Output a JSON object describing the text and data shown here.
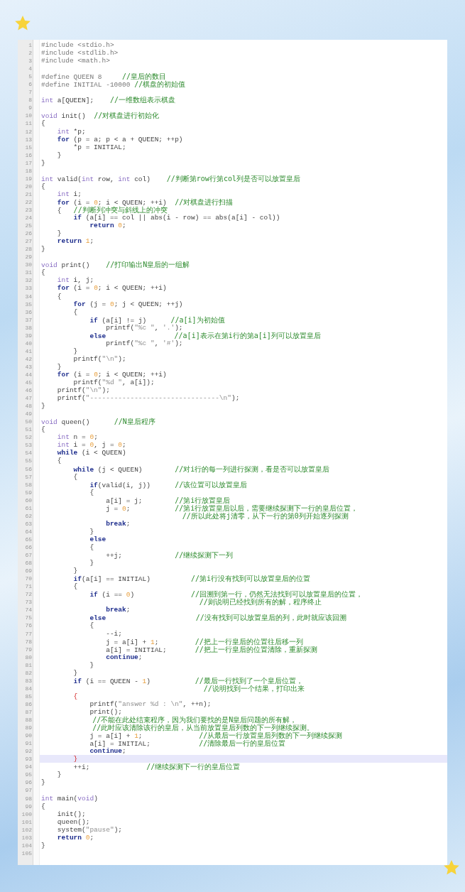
{
  "lines": [
    {
      "number": "1",
      "tokens": [
        {
          "kind": "pre",
          "text": "#include <stdio.h>"
        }
      ]
    },
    {
      "number": "2",
      "tokens": [
        {
          "kind": "pre",
          "text": "#include <stdlib.h>"
        }
      ]
    },
    {
      "number": "3",
      "tokens": [
        {
          "kind": "pre",
          "text": "#include <math.h>"
        }
      ]
    },
    {
      "number": "4"
    },
    {
      "number": "5",
      "tokens": [
        {
          "kind": "pre",
          "text": "#define QUEEN 8     "
        },
        {
          "kind": "comment",
          "text": "//皇后的数目"
        }
      ]
    },
    {
      "number": "6",
      "tokens": [
        {
          "kind": "pre",
          "text": "#define INITIAL -10000 "
        },
        {
          "kind": "comment",
          "text": "//棋盘的初始值"
        }
      ]
    },
    {
      "number": "7"
    },
    {
      "number": "8",
      "tokens": [
        {
          "kind": "type",
          "text": "int"
        },
        {
          "kind": "plain",
          "text": " a[QUEEN];    "
        },
        {
          "kind": "comment",
          "text": "//一维数组表示棋盘"
        }
      ]
    },
    {
      "number": "9"
    },
    {
      "number": "10",
      "tokens": [
        {
          "kind": "type",
          "text": "void"
        },
        {
          "kind": "plain",
          "text": " init()  "
        },
        {
          "kind": "comment",
          "text": "//对棋盘进行初始化"
        }
      ]
    },
    {
      "number": "11",
      "tokens": [
        {
          "kind": "plain",
          "text": "{"
        }
      ]
    },
    {
      "number": "12",
      "tokens": [
        {
          "kind": "type",
          "text": "    int"
        },
        {
          "kind": "plain",
          "text": " *p;"
        }
      ]
    },
    {
      "number": "13",
      "tokens": [
        {
          "kind": "keyword",
          "text": "    for"
        },
        {
          "kind": "plain",
          "text": " (p = a; p < a + QUEEN; ++p)"
        }
      ]
    },
    {
      "number": "15",
      "tokens": [
        {
          "kind": "plain",
          "text": "        *p = INITIAL;"
        }
      ]
    },
    {
      "number": "16",
      "tokens": [
        {
          "kind": "plain",
          "text": "    }"
        }
      ]
    },
    {
      "number": "17",
      "tokens": [
        {
          "kind": "plain",
          "text": "}"
        }
      ]
    },
    {
      "number": "18"
    },
    {
      "number": "19",
      "tokens": [
        {
          "kind": "type",
          "text": "int"
        },
        {
          "kind": "plain",
          "text": " valid("
        },
        {
          "kind": "type",
          "text": "int"
        },
        {
          "kind": "plain",
          "text": " row, "
        },
        {
          "kind": "type",
          "text": "int"
        },
        {
          "kind": "plain",
          "text": " col)    "
        },
        {
          "kind": "comment",
          "text": "//判断第row行第col列是否可以放置皇后"
        }
      ]
    },
    {
      "number": "20",
      "tokens": [
        {
          "kind": "plain",
          "text": "{"
        }
      ]
    },
    {
      "number": "21",
      "tokens": [
        {
          "kind": "type",
          "text": "    int"
        },
        {
          "kind": "plain",
          "text": " i;"
        }
      ]
    },
    {
      "number": "22",
      "tokens": [
        {
          "kind": "keyword",
          "text": "    for"
        },
        {
          "kind": "plain",
          "text": " (i = "
        },
        {
          "kind": "number",
          "text": "0"
        },
        {
          "kind": "plain",
          "text": "; i < QUEEN; ++i)  "
        },
        {
          "kind": "comment",
          "text": "//对棋盘进行扫描"
        }
      ]
    },
    {
      "number": "23",
      "tokens": [
        {
          "kind": "plain",
          "text": "    {   "
        },
        {
          "kind": "comment",
          "text": "//判断列冲突与斜线上的冲突"
        }
      ]
    },
    {
      "number": "24",
      "tokens": [
        {
          "kind": "keyword",
          "text": "        if"
        },
        {
          "kind": "plain",
          "text": " (a[i] == col || abs(i - row) == abs(a[i] - col))"
        }
      ]
    },
    {
      "number": "25",
      "tokens": [
        {
          "kind": "keyword",
          "text": "            return "
        },
        {
          "kind": "number",
          "text": "0"
        },
        {
          "kind": "plain",
          "text": ";"
        }
      ]
    },
    {
      "number": "26",
      "tokens": [
        {
          "kind": "plain",
          "text": "    }"
        }
      ]
    },
    {
      "number": "27",
      "tokens": [
        {
          "kind": "keyword",
          "text": "    return "
        },
        {
          "kind": "number",
          "text": "1"
        },
        {
          "kind": "plain",
          "text": ";"
        }
      ]
    },
    {
      "number": "28",
      "tokens": [
        {
          "kind": "plain",
          "text": "}"
        }
      ]
    },
    {
      "number": "29"
    },
    {
      "number": "30",
      "tokens": [
        {
          "kind": "type",
          "text": "void"
        },
        {
          "kind": "plain",
          "text": " print()    "
        },
        {
          "kind": "comment",
          "text": "//打印输出N皇后的一组解"
        }
      ]
    },
    {
      "number": "31",
      "tokens": [
        {
          "kind": "plain",
          "text": "{"
        }
      ]
    },
    {
      "number": "32",
      "tokens": [
        {
          "kind": "type",
          "text": "    int"
        },
        {
          "kind": "plain",
          "text": " i, j;"
        }
      ]
    },
    {
      "number": "33",
      "tokens": [
        {
          "kind": "keyword",
          "text": "    for"
        },
        {
          "kind": "plain",
          "text": " (i = "
        },
        {
          "kind": "number",
          "text": "0"
        },
        {
          "kind": "plain",
          "text": "; i < QUEEN; ++i)"
        }
      ]
    },
    {
      "number": "34",
      "tokens": [
        {
          "kind": "plain",
          "text": "    {"
        }
      ]
    },
    {
      "number": "35",
      "tokens": [
        {
          "kind": "keyword",
          "text": "        for"
        },
        {
          "kind": "plain",
          "text": " (j = "
        },
        {
          "kind": "number",
          "text": "0"
        },
        {
          "kind": "plain",
          "text": "; j < QUEEN; ++j)"
        }
      ]
    },
    {
      "number": "36",
      "tokens": [
        {
          "kind": "plain",
          "text": "        {"
        }
      ]
    },
    {
      "number": "37",
      "tokens": [
        {
          "kind": "keyword",
          "text": "            if"
        },
        {
          "kind": "plain",
          "text": " (a[i] != j)      "
        },
        {
          "kind": "comment",
          "text": "//a[i]为初始值"
        }
      ]
    },
    {
      "number": "38",
      "tokens": [
        {
          "kind": "plain",
          "text": "                printf("
        },
        {
          "kind": "string",
          "text": "\"%c \""
        },
        {
          "kind": "plain",
          "text": ", "
        },
        {
          "kind": "string",
          "text": "'.'"
        },
        {
          "kind": "plain",
          "text": ");"
        }
      ]
    },
    {
      "number": "39",
      "tokens": [
        {
          "kind": "keyword",
          "text": "            else"
        },
        {
          "kind": "comment",
          "text": "                //a[i]表示在第i行的第a[i]列可以放置皇后"
        }
      ]
    },
    {
      "number": "40",
      "tokens": [
        {
          "kind": "plain",
          "text": "                printf("
        },
        {
          "kind": "string",
          "text": "\"%c \""
        },
        {
          "kind": "plain",
          "text": ", "
        },
        {
          "kind": "string",
          "text": "'#'"
        },
        {
          "kind": "plain",
          "text": ");"
        }
      ]
    },
    {
      "number": "41",
      "tokens": [
        {
          "kind": "plain",
          "text": "        }"
        }
      ]
    },
    {
      "number": "42",
      "tokens": [
        {
          "kind": "plain",
          "text": "        printf("
        },
        {
          "kind": "string",
          "text": "\"\\n\""
        },
        {
          "kind": "plain",
          "text": ");"
        }
      ]
    },
    {
      "number": "43",
      "tokens": [
        {
          "kind": "plain",
          "text": "    }"
        }
      ]
    },
    {
      "number": "44",
      "tokens": [
        {
          "kind": "keyword",
          "text": "    for"
        },
        {
          "kind": "plain",
          "text": " (i = "
        },
        {
          "kind": "number",
          "text": "0"
        },
        {
          "kind": "plain",
          "text": "; i < QUEEN; ++i)"
        }
      ]
    },
    {
      "number": "45",
      "tokens": [
        {
          "kind": "plain",
          "text": "        printf("
        },
        {
          "kind": "string",
          "text": "\"%d \""
        },
        {
          "kind": "plain",
          "text": ", a[i]);"
        }
      ]
    },
    {
      "number": "46",
      "tokens": [
        {
          "kind": "plain",
          "text": "    printf("
        },
        {
          "kind": "string",
          "text": "\"\\n\""
        },
        {
          "kind": "plain",
          "text": ");"
        }
      ]
    },
    {
      "number": "47",
      "tokens": [
        {
          "kind": "plain",
          "text": "    printf("
        },
        {
          "kind": "string",
          "text": "\"--------------------------------\\n\""
        },
        {
          "kind": "plain",
          "text": ");"
        }
      ]
    },
    {
      "number": "48",
      "tokens": [
        {
          "kind": "plain",
          "text": "}"
        }
      ]
    },
    {
      "number": "49"
    },
    {
      "number": "50",
      "tokens": [
        {
          "kind": "type",
          "text": "void"
        },
        {
          "kind": "plain",
          "text": " queen()      "
        },
        {
          "kind": "comment",
          "text": "//N皇后程序"
        }
      ]
    },
    {
      "number": "51",
      "tokens": [
        {
          "kind": "plain",
          "text": "{"
        }
      ]
    },
    {
      "number": "52",
      "tokens": [
        {
          "kind": "type",
          "text": "    int"
        },
        {
          "kind": "plain",
          "text": " n = "
        },
        {
          "kind": "number",
          "text": "0"
        },
        {
          "kind": "plain",
          "text": ";"
        }
      ]
    },
    {
      "number": "53",
      "tokens": [
        {
          "kind": "type",
          "text": "    int"
        },
        {
          "kind": "plain",
          "text": " i = "
        },
        {
          "kind": "number",
          "text": "0"
        },
        {
          "kind": "plain",
          "text": ", j = "
        },
        {
          "kind": "number",
          "text": "0"
        },
        {
          "kind": "plain",
          "text": ";"
        }
      ]
    },
    {
      "number": "54",
      "tokens": [
        {
          "kind": "keyword",
          "text": "    while"
        },
        {
          "kind": "plain",
          "text": " (i < QUEEN)"
        }
      ]
    },
    {
      "number": "55",
      "tokens": [
        {
          "kind": "plain",
          "text": "    {"
        }
      ]
    },
    {
      "number": "56",
      "tokens": [
        {
          "kind": "keyword",
          "text": "        while"
        },
        {
          "kind": "plain",
          "text": " (j < QUEEN)        "
        },
        {
          "kind": "comment",
          "text": "//对i行的每一列进行探测，看是否可以放置皇后"
        }
      ]
    },
    {
      "number": "57",
      "tokens": [
        {
          "kind": "plain",
          "text": "        {"
        }
      ]
    },
    {
      "number": "58",
      "tokens": [
        {
          "kind": "keyword",
          "text": "            if"
        },
        {
          "kind": "plain",
          "text": "(valid(i, j))      "
        },
        {
          "kind": "comment",
          "text": "//该位置可以放置皇后"
        }
      ]
    },
    {
      "number": "59",
      "tokens": [
        {
          "kind": "plain",
          "text": "            {"
        }
      ]
    },
    {
      "number": "60",
      "tokens": [
        {
          "kind": "plain",
          "text": "                a[i] = j;        "
        },
        {
          "kind": "comment",
          "text": "//第i行放置皇后"
        }
      ]
    },
    {
      "number": "61",
      "tokens": [
        {
          "kind": "plain",
          "text": "                j = "
        },
        {
          "kind": "number",
          "text": "0"
        },
        {
          "kind": "plain",
          "text": ";           "
        },
        {
          "kind": "comment",
          "text": "//第i行放置皇后以后，需要继续探测下一行的皇后位置，"
        }
      ]
    },
    {
      "number": "62",
      "tokens": [
        {
          "kind": "comment",
          "text": "                                 //所以此处将j清零，从下一行的第0列开始逐列探测"
        }
      ]
    },
    {
      "number": "63",
      "tokens": [
        {
          "kind": "keyword",
          "text": "                break"
        },
        {
          "kind": "plain",
          "text": ";"
        }
      ]
    },
    {
      "number": "64",
      "tokens": [
        {
          "kind": "plain",
          "text": "            }"
        }
      ]
    },
    {
      "number": "65",
      "tokens": [
        {
          "kind": "keyword",
          "text": "            else"
        }
      ]
    },
    {
      "number": "66",
      "tokens": [
        {
          "kind": "plain",
          "text": "            {"
        }
      ]
    },
    {
      "number": "67",
      "tokens": [
        {
          "kind": "plain",
          "text": "                ++j;             "
        },
        {
          "kind": "comment",
          "text": "//继续探测下一列"
        }
      ]
    },
    {
      "number": "68",
      "tokens": [
        {
          "kind": "plain",
          "text": "            }"
        }
      ]
    },
    {
      "number": "69",
      "tokens": [
        {
          "kind": "plain",
          "text": "        }"
        }
      ]
    },
    {
      "number": "70",
      "tokens": [
        {
          "kind": "keyword",
          "text": "        if"
        },
        {
          "kind": "plain",
          "text": "(a[i] == INITIAL)          "
        },
        {
          "kind": "comment",
          "text": "//第i行没有找到可以放置皇后的位置"
        }
      ]
    },
    {
      "number": "71",
      "tokens": [
        {
          "kind": "plain",
          "text": "        {"
        }
      ]
    },
    {
      "number": "72",
      "tokens": [
        {
          "kind": "keyword",
          "text": "            if"
        },
        {
          "kind": "plain",
          "text": " (i == "
        },
        {
          "kind": "number",
          "text": "0"
        },
        {
          "kind": "plain",
          "text": ")              "
        },
        {
          "kind": "comment",
          "text": "//回溯到第一行，仍然无法找到可以放置皇后的位置，"
        }
      ]
    },
    {
      "number": "73",
      "tokens": [
        {
          "kind": "comment",
          "text": "                                     //则说明已经找到所有的解，程序终止"
        }
      ]
    },
    {
      "number": "74",
      "tokens": [
        {
          "kind": "keyword",
          "text": "                break"
        },
        {
          "kind": "plain",
          "text": ";"
        }
      ]
    },
    {
      "number": "75",
      "tokens": [
        {
          "kind": "keyword",
          "text": "            else"
        },
        {
          "kind": "comment",
          "text": "                     //没有找到可以放置皇后的列，此时就应该回溯"
        }
      ]
    },
    {
      "number": "76",
      "tokens": [
        {
          "kind": "plain",
          "text": "            {"
        }
      ]
    },
    {
      "number": "77",
      "tokens": [
        {
          "kind": "plain",
          "text": "                --i;"
        }
      ]
    },
    {
      "number": "78",
      "tokens": [
        {
          "kind": "plain",
          "text": "                j = a[i] + "
        },
        {
          "kind": "number",
          "text": "1"
        },
        {
          "kind": "plain",
          "text": ";         "
        },
        {
          "kind": "comment",
          "text": "//把上一行皇后的位置往后移一列"
        }
      ]
    },
    {
      "number": "79",
      "tokens": [
        {
          "kind": "plain",
          "text": "                a[i] = INITIAL;       "
        },
        {
          "kind": "comment",
          "text": "//把上一行皇后的位置清除，重新探测"
        }
      ]
    },
    {
      "number": "80",
      "tokens": [
        {
          "kind": "keyword",
          "text": "                continue"
        },
        {
          "kind": "plain",
          "text": ";"
        }
      ]
    },
    {
      "number": "81",
      "tokens": [
        {
          "kind": "plain",
          "text": "            }"
        }
      ]
    },
    {
      "number": "82",
      "tokens": [
        {
          "kind": "plain",
          "text": "        }"
        }
      ]
    },
    {
      "number": "83",
      "tokens": [
        {
          "kind": "keyword",
          "text": "        if"
        },
        {
          "kind": "plain",
          "text": " (i == QUEEN - "
        },
        {
          "kind": "number",
          "text": "1"
        },
        {
          "kind": "plain",
          "text": ")           "
        },
        {
          "kind": "comment",
          "text": "//最后一行找到了一个皇后位置，"
        }
      ]
    },
    {
      "number": "84",
      "tokens": [
        {
          "kind": "comment",
          "text": "                                      //说明找到一个结果，打印出来"
        }
      ]
    },
    {
      "number": "85",
      "tokens": [
        {
          "kind": "brace",
          "text": "        {"
        }
      ]
    },
    {
      "number": "86",
      "tokens": [
        {
          "kind": "plain",
          "text": "            printf("
        },
        {
          "kind": "string",
          "text": "\"answer %d : \\n\""
        },
        {
          "kind": "plain",
          "text": ", ++n);"
        }
      ]
    },
    {
      "number": "87",
      "tokens": [
        {
          "kind": "plain",
          "text": "            print();"
        }
      ]
    },
    {
      "number": "88",
      "tokens": [
        {
          "kind": "comment",
          "text": "            //不能在此处结束程序，因为我们要找的是N皇后问题的所有解，"
        }
      ]
    },
    {
      "number": "89",
      "tokens": [
        {
          "kind": "comment",
          "text": "            //此时应该清除该行的皇后，从当前放置皇后列数的下一列继续探测。"
        }
      ]
    },
    {
      "number": "90",
      "tokens": [
        {
          "kind": "plain",
          "text": "            j = a[i] + "
        },
        {
          "kind": "number",
          "text": "1"
        },
        {
          "kind": "plain",
          "text": ";              "
        },
        {
          "kind": "comment",
          "text": "//从最后一行放置皇后列数的下一列继续探测"
        }
      ]
    },
    {
      "number": "91",
      "tokens": [
        {
          "kind": "plain",
          "text": "            a[i] = INITIAL;            "
        },
        {
          "kind": "comment",
          "text": "//清除最后一行的皇后位置"
        }
      ]
    },
    {
      "number": "92",
      "tokens": [
        {
          "kind": "keyword",
          "text": "            continue"
        },
        {
          "kind": "plain",
          "text": ";"
        }
      ]
    },
    {
      "number": "93",
      "current": true,
      "tokens": [
        {
          "kind": "brace",
          "text": "        }"
        }
      ]
    },
    {
      "number": "94",
      "tokens": [
        {
          "kind": "plain",
          "text": "        ++i;              "
        },
        {
          "kind": "comment",
          "text": "//继续探测下一行的皇后位置"
        }
      ]
    },
    {
      "number": "95",
      "tokens": [
        {
          "kind": "plain",
          "text": "    }"
        }
      ]
    },
    {
      "number": "96",
      "tokens": [
        {
          "kind": "plain",
          "text": "}"
        }
      ]
    },
    {
      "number": "97"
    },
    {
      "number": "98",
      "tokens": [
        {
          "kind": "type",
          "text": "int"
        },
        {
          "kind": "plain",
          "text": " main("
        },
        {
          "kind": "type",
          "text": "void"
        },
        {
          "kind": "plain",
          "text": ")"
        }
      ]
    },
    {
      "number": "99",
      "tokens": [
        {
          "kind": "plain",
          "text": "{"
        }
      ]
    },
    {
      "number": "100",
      "tokens": [
        {
          "kind": "plain",
          "text": "    init();"
        }
      ]
    },
    {
      "number": "101",
      "tokens": [
        {
          "kind": "plain",
          "text": "    queen();"
        }
      ]
    },
    {
      "number": "102",
      "tokens": [
        {
          "kind": "plain",
          "text": "    system("
        },
        {
          "kind": "string",
          "text": "\"pause\""
        },
        {
          "kind": "plain",
          "text": ");"
        }
      ]
    },
    {
      "number": "103",
      "tokens": [
        {
          "kind": "keyword",
          "text": "    return "
        },
        {
          "kind": "number",
          "text": "0"
        },
        {
          "kind": "plain",
          "text": ";"
        }
      ]
    },
    {
      "number": "104",
      "tokens": [
        {
          "kind": "plain",
          "text": "}"
        }
      ]
    },
    {
      "number": "105"
    }
  ]
}
